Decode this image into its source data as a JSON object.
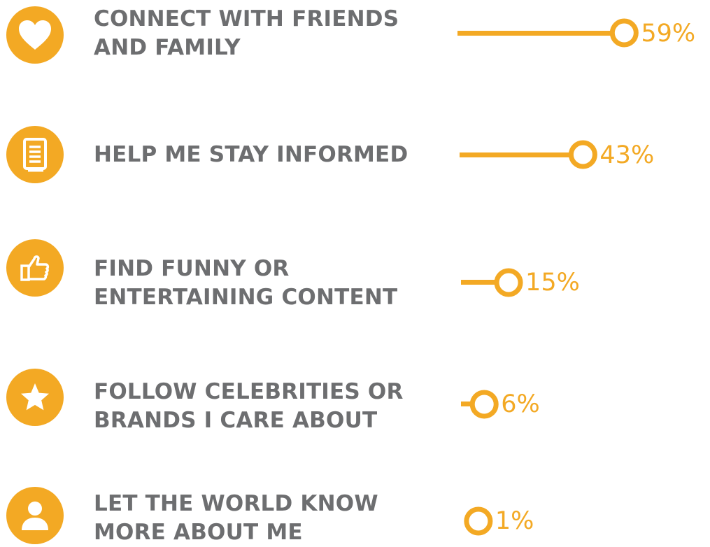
{
  "colors": {
    "accent": "#f3a924",
    "text": "#6d6e70"
  },
  "chart_data": {
    "type": "bar",
    "orientation": "horizontal",
    "categories": [
      "CONNECT WITH FRIENDS AND FAMILY",
      "HELP ME STAY INFORMED",
      "FIND FUNNY OR ENTERTAINING CONTENT",
      "FOLLOW CELEBRITIES OR BRANDS I CARE ABOUT",
      "LET THE WORLD KNOW MORE ABOUT ME"
    ],
    "values": [
      59,
      43,
      15,
      6,
      1
    ],
    "unit": "%"
  },
  "items": [
    {
      "label_lines": [
        "CONNECT WITH FRIENDS",
        "AND FAMILY"
      ],
      "value": 59,
      "value_label": "59%",
      "icon": "heart-icon"
    },
    {
      "label_lines": [
        "HELP ME STAY INFORMED"
      ],
      "value": 43,
      "value_label": "43%",
      "icon": "document-icon"
    },
    {
      "label_lines": [
        "FIND FUNNY OR",
        "ENTERTAINING CONTENT"
      ],
      "value": 15,
      "value_label": "15%",
      "icon": "thumbs-up-icon"
    },
    {
      "label_lines": [
        "FOLLOW CELEBRITIES OR",
        "BRANDS I CARE ABOUT"
      ],
      "value": 6,
      "value_label": "6%",
      "icon": "star-icon"
    },
    {
      "label_lines": [
        "LET THE WORLD KNOW",
        "MORE ABOUT ME"
      ],
      "value": 1,
      "value_label": "1%",
      "icon": "person-icon"
    }
  ]
}
